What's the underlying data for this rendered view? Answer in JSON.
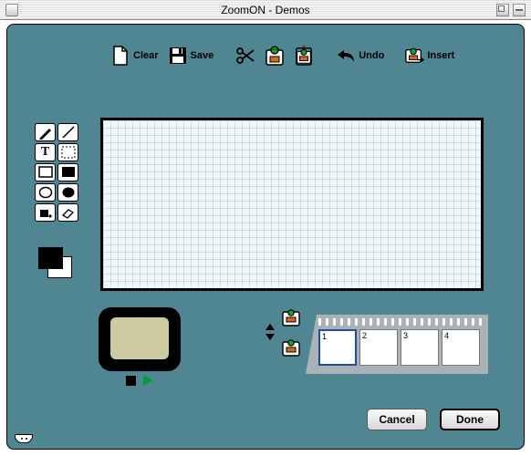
{
  "window": {
    "title": "ZoomON - Demos"
  },
  "toolbar": {
    "clear": "Clear",
    "save": "Save",
    "undo": "Undo",
    "insert": "Insert"
  },
  "tools": {
    "row1": [
      "pencil",
      "line"
    ],
    "row2": [
      "text",
      "marquee"
    ],
    "row3": [
      "rect-outline",
      "rect-filled"
    ],
    "row4": [
      "circle-outline",
      "circle-filled"
    ],
    "row5": [
      "bucket",
      "eraser"
    ]
  },
  "colors": {
    "foreground": "#000000",
    "background": "#ffffff"
  },
  "frames": {
    "count": 4,
    "labels": [
      "1",
      "2",
      "3",
      "4"
    ],
    "selected": 1
  },
  "buttons": {
    "cancel": "Cancel",
    "done": "Done"
  }
}
